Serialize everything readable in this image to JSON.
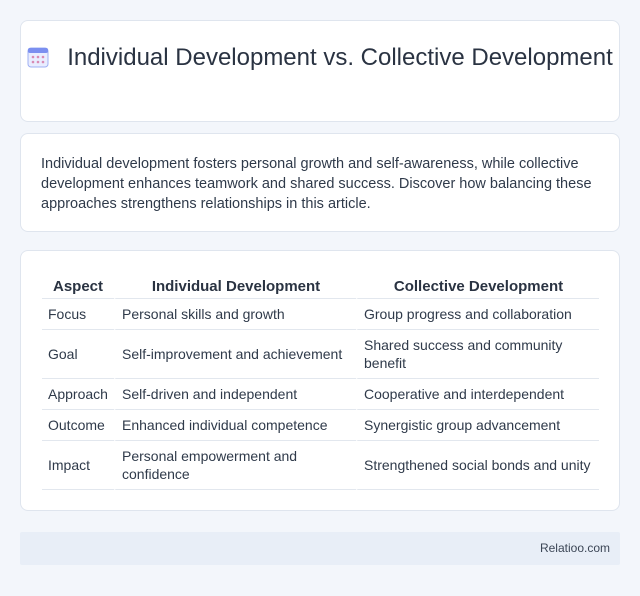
{
  "header": {
    "title": "Individual Development vs. Collective Development",
    "icon": "calendar-icon"
  },
  "intro": {
    "text": "Individual development fosters personal growth and self-awareness, while collective development enhances teamwork and shared success. Discover how balancing these approaches strengthens relationships in this article."
  },
  "table": {
    "headers": [
      "Aspect",
      "Individual Development",
      "Collective Development"
    ],
    "rows": [
      [
        "Focus",
        "Personal skills and growth",
        "Group progress and collaboration"
      ],
      [
        "Goal",
        "Self-improvement and achievement",
        "Shared success and community benefit"
      ],
      [
        "Approach",
        "Self-driven and independent",
        "Cooperative and interdependent"
      ],
      [
        "Outcome",
        "Enhanced individual competence",
        "Synergistic group advancement"
      ],
      [
        "Impact",
        "Personal empowerment and confidence",
        "Strengthened social bonds and unity"
      ]
    ]
  },
  "footer": {
    "brand": "Relatioo.com"
  },
  "colors": {
    "background": "#f3f6fb",
    "card": "#ffffff",
    "footer": "#e8eef7",
    "icon_accent": "#7b8ff0"
  }
}
